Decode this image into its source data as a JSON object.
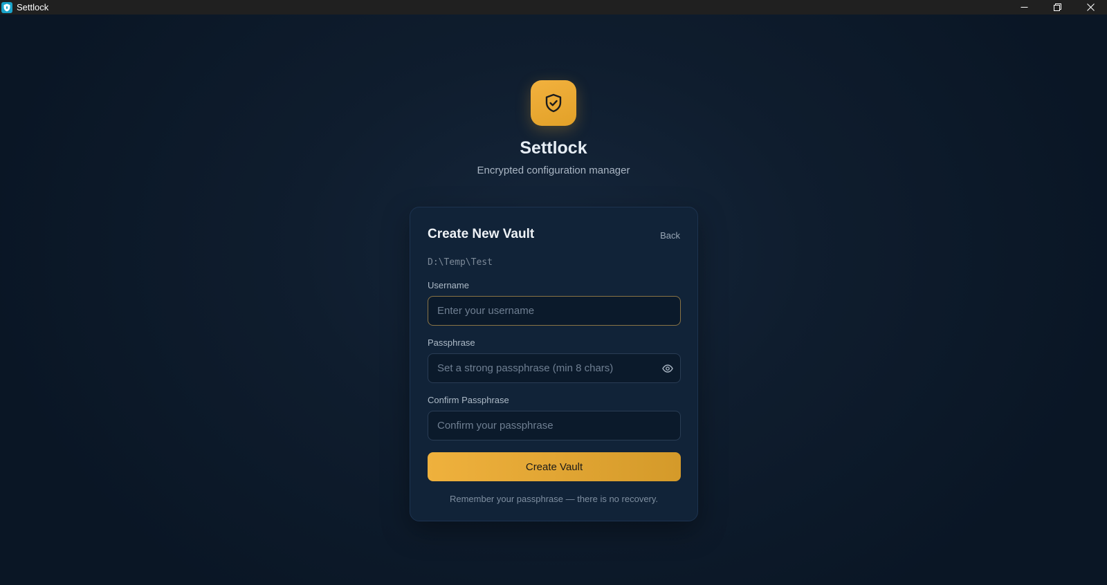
{
  "window": {
    "title": "Settlock",
    "icon": "shield-icon"
  },
  "window_controls": {
    "minimize_icon": "minimize-icon",
    "restore_icon": "restore-icon",
    "close_icon": "close-icon"
  },
  "brand": {
    "logo_icon": "shield-check-icon",
    "name": "Settlock",
    "tagline": "Encrypted configuration manager",
    "accent_color": "#f0b03c"
  },
  "card": {
    "title": "Create New Vault",
    "back_label": "Back",
    "path": "D:\\Temp\\Test",
    "username": {
      "label": "Username",
      "value": "",
      "placeholder": "Enter your username"
    },
    "passphrase": {
      "label": "Passphrase",
      "value": "",
      "placeholder": "Set a strong passphrase (min 8 chars)",
      "toggle_icon": "eye-icon"
    },
    "confirm_passphrase": {
      "label": "Confirm Passphrase",
      "value": "",
      "placeholder": "Confirm your passphrase"
    },
    "submit_label": "Create Vault",
    "footer_note": "Remember your passphrase — there is no recovery."
  },
  "colors": {
    "background": "#0f1d2e",
    "card": "#112338",
    "button_gradient_start": "#efb13d",
    "button_gradient_end": "#d49a2a"
  }
}
